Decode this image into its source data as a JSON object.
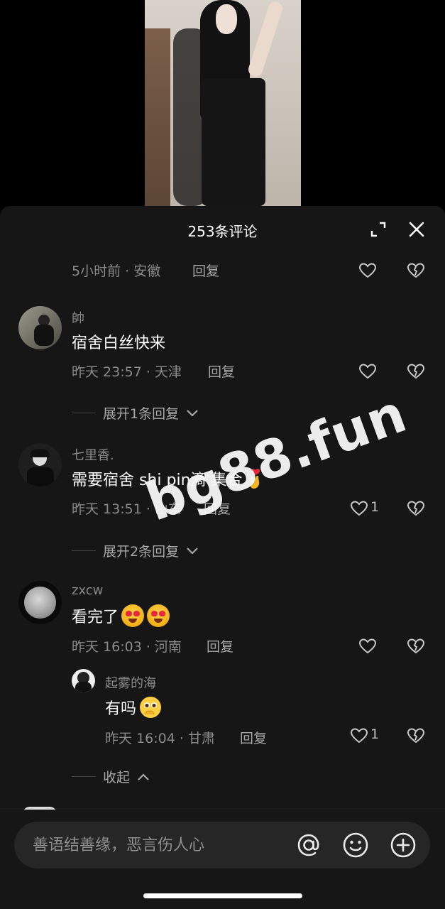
{
  "video": {
    "description_hidden": true
  },
  "sheet": {
    "title": "253条评论"
  },
  "comments": [
    {
      "meta": "5小时前 · 安徽",
      "reply": "回复"
    },
    {
      "name": "帥",
      "text": "宿舍白丝快来",
      "meta": "昨天 23:57 · 天津",
      "reply": "回复",
      "expand": "展开1条回复"
    },
    {
      "name": "七里香.",
      "text": "需要宿舍 shi pin滴 集合",
      "meta": "昨天 13:51 · 山东",
      "reply": "回复",
      "likes": "1",
      "expand": "展开2条回复"
    },
    {
      "name": "zxcw",
      "text": "看完了",
      "meta": "昨天 16:03 · 河南",
      "reply": "回复"
    }
  ],
  "sub_reply": {
    "name": "起雾的海",
    "text": "有吗",
    "meta": "昨天 16:04 · 甘肃",
    "reply": "回复",
    "likes": "1",
    "collapse": "收起"
  },
  "watermark": "bg88.fun",
  "input": {
    "placeholder": "善语结善缘，恶言伤人心"
  },
  "icons": {
    "expand": "expand-icon",
    "close": "close-icon",
    "like": "heart-icon",
    "dislike": "broken-heart-icon",
    "mention": "at-icon",
    "emoji": "smiley-icon",
    "add": "plus-circle-icon"
  }
}
